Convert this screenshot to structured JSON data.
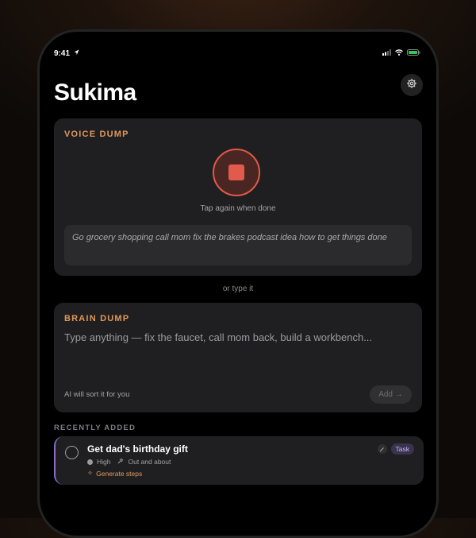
{
  "status_bar": {
    "time": "9:41"
  },
  "app": {
    "title": "Sukima"
  },
  "voice_dump": {
    "label": "VOICE DUMP",
    "hint": "Tap again when done",
    "transcript": "Go grocery shopping call mom fix the brakes podcast idea how to get things done"
  },
  "divider_text": "or type it",
  "brain_dump": {
    "label": "BRAIN DUMP",
    "placeholder": "Type anything — fix the faucet, call mom back, build a workbench...",
    "note": "AI will sort it for you",
    "add_label": "Add →"
  },
  "recent": {
    "label": "RECENTLY ADDED",
    "items": [
      {
        "title": "Get dad's birthday gift",
        "priority": "High",
        "context": "Out and about",
        "action": "Generate steps",
        "type": "Task"
      }
    ]
  },
  "colors": {
    "accent": "#e0975a",
    "record": "#e25a4b",
    "tag": "#c7b6ee"
  }
}
